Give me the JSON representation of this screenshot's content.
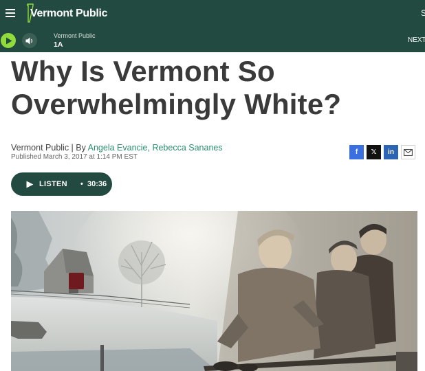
{
  "header": {
    "logo_text": "Vermont Public",
    "edge_letter": "S",
    "colors": {
      "bar": "#234a40",
      "play_accent": "#8fdc3c",
      "link": "#2b8e6f"
    }
  },
  "player": {
    "station": "Vermont Public",
    "program": "1A",
    "next_label": "NEXT"
  },
  "article": {
    "headline": "Why Is Vermont So Overwhelmingly White?",
    "byline_source": "Vermont Public | By ",
    "byline_authors": "Angela Evancie, Rebecca Sananes",
    "published": "Published March 3, 2017 at 1:14 PM EST",
    "listen_label": "LISTEN",
    "listen_separator": "•",
    "listen_duration": "30:36"
  },
  "share": {
    "facebook": "f",
    "x": "𝕏",
    "linkedin": "in"
  },
  "icons": [
    "menu-icon",
    "vermont-logo-icon",
    "play-icon",
    "volume-icon",
    "facebook-icon",
    "x-icon",
    "linkedin-icon",
    "mail-icon"
  ]
}
